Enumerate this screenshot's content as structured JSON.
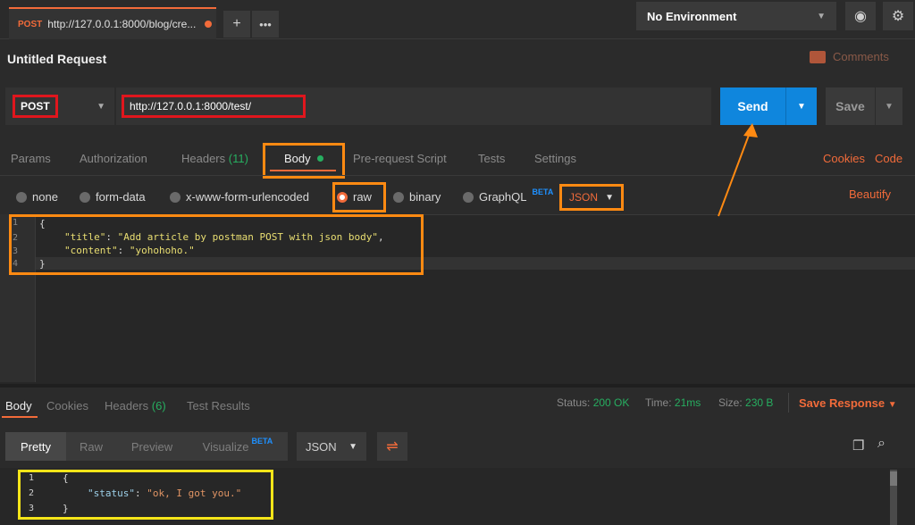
{
  "tab": {
    "method": "POST",
    "url": "http://127.0.0.1:8000/blog/cre..."
  },
  "environment": {
    "selected": "No Environment"
  },
  "request": {
    "title": "Untitled Request",
    "comments_label": "Comments",
    "method": "POST",
    "url": "http://127.0.0.1:8000/test/",
    "send_label": "Send",
    "save_label": "Save"
  },
  "request_tabs": {
    "params": "Params",
    "authorization": "Authorization",
    "headers": "Headers",
    "headers_count": "(11)",
    "body": "Body",
    "pre_request": "Pre-request Script",
    "tests": "Tests",
    "settings": "Settings",
    "cookies": "Cookies",
    "code": "Code"
  },
  "body_types": {
    "none": "none",
    "form_data": "form-data",
    "urlencoded": "x-www-form-urlencoded",
    "raw": "raw",
    "binary": "binary",
    "graphql": "GraphQL",
    "beta": "BETA",
    "format": "JSON",
    "beautify": "Beautify"
  },
  "request_body": {
    "line_numbers": [
      "1",
      "2",
      "3",
      "4"
    ],
    "open_brace": "{",
    "title_key": "\"title\"",
    "title_value": "\"Add article by postman POST with json body\"",
    "content_key": "\"content\"",
    "content_value": "\"yohohoho.\"",
    "close_brace": "}"
  },
  "response": {
    "tabs": {
      "body": "Body",
      "cookies": "Cookies",
      "headers": "Headers",
      "headers_count": "(6)",
      "test_results": "Test Results"
    },
    "status_label": "Status:",
    "status_value": "200 OK",
    "time_label": "Time:",
    "time_value": "21ms",
    "size_label": "Size:",
    "size_value": "230 B",
    "save_response": "Save Response",
    "views": {
      "pretty": "Pretty",
      "raw": "Raw",
      "preview": "Preview",
      "visualize": "Visualize",
      "beta": "BETA"
    },
    "format": "JSON",
    "line_numbers": [
      "1",
      "2",
      "3"
    ],
    "open_brace": "{",
    "status_key": "\"status\"",
    "status_value_text": "\"ok, I got you.\"",
    "close_brace": "}"
  },
  "colors": {
    "accent": "#f26b3a",
    "send": "#0f86dd",
    "success": "#27ae60",
    "highlight_orange": "#ff8a12",
    "highlight_red": "#e0161d",
    "highlight_yellow": "#f5e519"
  },
  "icons": [
    "plus-icon",
    "more-icon",
    "eye-icon",
    "gear-icon",
    "comment-icon",
    "wrap-icon",
    "copy-icon",
    "search-icon"
  ]
}
